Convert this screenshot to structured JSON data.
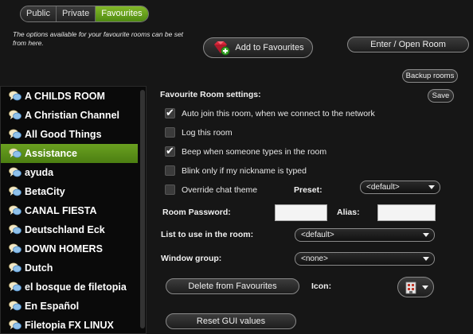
{
  "tabs": [
    {
      "label": "Public",
      "active": false
    },
    {
      "label": "Private",
      "active": false
    },
    {
      "label": "Favourites",
      "active": true
    }
  ],
  "note": "The options available for your favourite rooms can be set from here.",
  "buttons": {
    "add": "Add to Favourites",
    "enter": "Enter / Open Room",
    "backup": "Backup rooms",
    "save": "Save",
    "delete": "Delete from Favourites",
    "reset": "Reset GUI values"
  },
  "rooms": [
    {
      "name": "A CHILDS ROOM",
      "selected": false
    },
    {
      "name": "A Christian Channel",
      "selected": false
    },
    {
      "name": "All Good Things",
      "selected": false
    },
    {
      "name": "Assistance",
      "selected": true
    },
    {
      "name": "ayuda",
      "selected": false
    },
    {
      "name": "BetaCity",
      "selected": false
    },
    {
      "name": "CANAL FIESTA",
      "selected": false
    },
    {
      "name": "Deutschland Eck",
      "selected": false
    },
    {
      "name": "DOWN HOMERS",
      "selected": false
    },
    {
      "name": "Dutch",
      "selected": false
    },
    {
      "name": "el bosque de filetopia",
      "selected": false
    },
    {
      "name": "En Español",
      "selected": false
    },
    {
      "name": "Filetopia FX LINUX",
      "selected": false
    }
  ],
  "settings": {
    "heading": "Favourite Room settings:",
    "options": [
      {
        "label": "Auto join this room, when we connect to the network",
        "checked": true
      },
      {
        "label": "Log this room",
        "checked": false
      },
      {
        "label": "Beep when someone types in the room",
        "checked": true
      },
      {
        "label": "Blink only if my nickname is typed",
        "checked": false
      },
      {
        "label": "Override chat theme",
        "checked": false
      }
    ],
    "preset_label": "Preset:",
    "preset_value": "<default>",
    "password_label": "Room Password:",
    "alias_label": "Alias:",
    "list_label": "List to use in the room:",
    "list_value": "<default>",
    "window_label": "Window group:",
    "window_value": "<none>",
    "icon_label": "Icon:"
  },
  "colors": {
    "accent": "#6aa020",
    "background": "#161616"
  }
}
